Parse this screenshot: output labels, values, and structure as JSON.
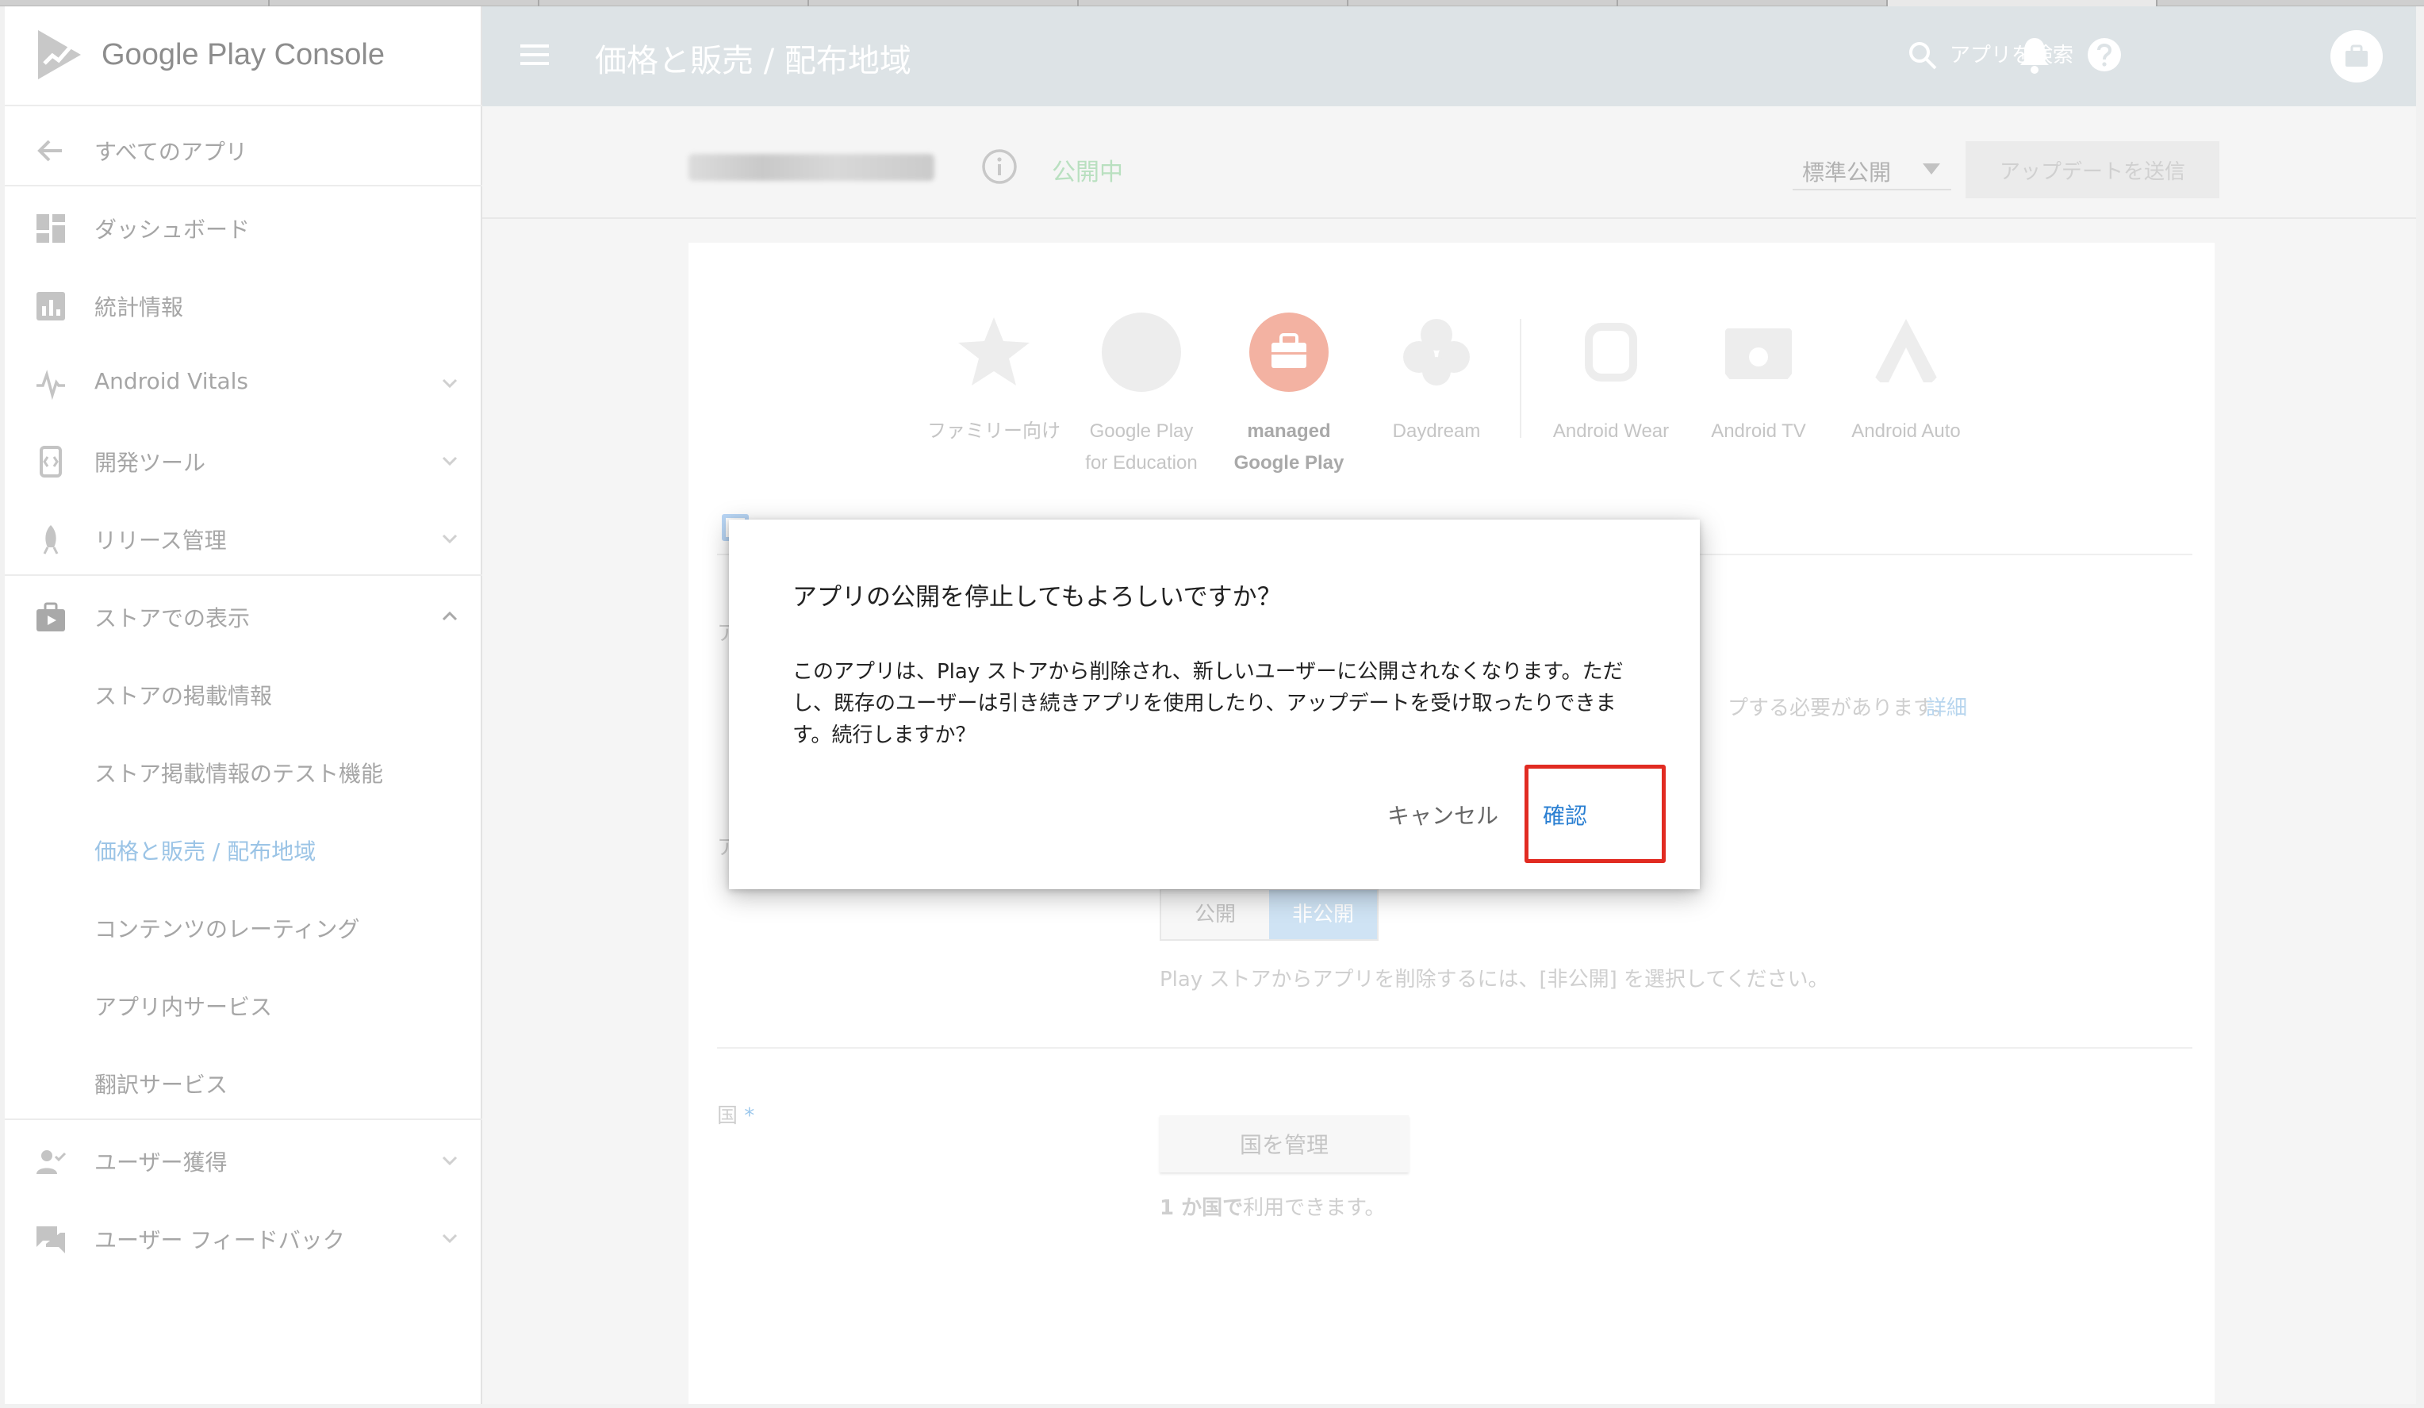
{
  "app": {
    "brand": "Google Play Console",
    "page_title": "価格と販売 / 配布地域",
    "search_placeholder": "アプリを検索",
    "status": "公開中",
    "track": "標準公開",
    "send_update": "アップデートを送信"
  },
  "sidebar": {
    "back": "すべてのアプリ",
    "items": [
      {
        "label": "ダッシュボード",
        "icon": "dashboard-icon"
      },
      {
        "label": "統計情報",
        "icon": "statistics-icon"
      },
      {
        "label": "Android Vitals",
        "icon": "vitals-icon"
      },
      {
        "label": "開発ツール",
        "icon": "dev-tools-icon"
      },
      {
        "label": "リリース管理",
        "icon": "rocket-icon"
      },
      {
        "label": "ストアでの表示",
        "icon": "store-icon"
      }
    ],
    "sub_items": [
      "ストアの掲載情報",
      "ストア掲載情報のテスト機能",
      "価格と販売 / 配布地域",
      "コンテンツのレーティング",
      "アプリ内サービス",
      "翻訳サービス"
    ],
    "bottom_items": [
      {
        "label": "ユーザー獲得",
        "icon": "user-acquisition-icon"
      },
      {
        "label": "ユーザー フィードバック",
        "icon": "feedback-icon"
      }
    ]
  },
  "platforms": [
    {
      "label": "ファミリー向け",
      "label_line2": ""
    },
    {
      "label": "Google Play",
      "label_line2": "for Education"
    },
    {
      "label": "managed",
      "label_line2": "Google Play"
    },
    {
      "label": "Daydream",
      "label_line2": ""
    },
    {
      "label": "Android Wear",
      "label_line2": ""
    },
    {
      "label": "Android TV",
      "label_line2": ""
    },
    {
      "label": "Android Auto",
      "label_line2": ""
    }
  ],
  "background": {
    "section_prefix_1": "ア",
    "section_prefix_2": "ア",
    "notice_tail": "プする必要があります。",
    "notice_link": "詳細",
    "toggle_public": "公開",
    "toggle_private": "非公開",
    "toggle_hint": "Play ストアからアプリを削除するには、[非公開] を選択してください。",
    "country_label": "国",
    "country_required": "*",
    "manage_countries": "国を管理",
    "available_count": "1 か国で",
    "available_suffix": "利用できます。"
  },
  "dialog": {
    "title": "アプリの公開を停止してもよろしいですか？",
    "body": "このアプリは、Play ストアから削除され、新しいユーザーに公開されなくなります。ただし、既存のユーザーは引き続きアプリを使用したり、アップデートを受け取ったりできます。続行しますか？",
    "cancel": "キャンセル",
    "confirm": "確認"
  },
  "colors": {
    "accent": "#2a7fd2",
    "highlight": "#e12b22",
    "managed_play": "#f3b2a2"
  }
}
